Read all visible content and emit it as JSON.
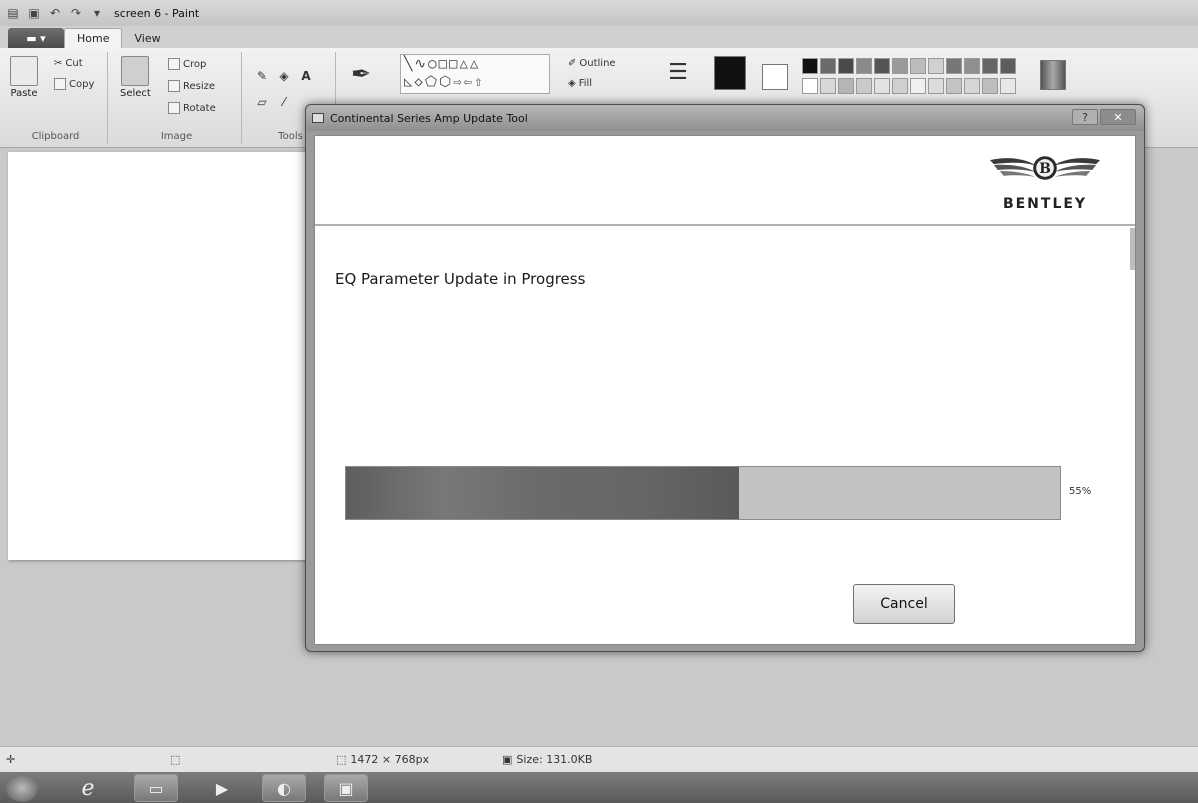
{
  "paint": {
    "window_title": "screen 6 - Paint",
    "tabs": [
      "Home",
      "View"
    ],
    "clipboard": {
      "paste": "Paste",
      "cut": "Cut",
      "copy": "Copy",
      "label": "Clipboard"
    },
    "image": {
      "select": "Select",
      "crop": "Crop",
      "resize": "Resize",
      "rotate": "Rotate",
      "label": "Image"
    },
    "tools": {
      "label": "Tools"
    },
    "shapes": {
      "outline": "Outline",
      "fill": "Fill"
    },
    "status": {
      "dimensions": "1472 × 768px",
      "size": "Size: 131.0KB"
    }
  },
  "dialog": {
    "title": "Continental Series Amp Update Tool",
    "caption_help": "?",
    "caption_close": "✕",
    "brand": "BENTLEY",
    "status_text": "EQ Parameter Update in Progress",
    "progress_value": 0.55,
    "progress_label": "55%",
    "cancel_label": "Cancel"
  },
  "icons": [
    "save-icon",
    "undo-icon",
    "redo-icon",
    "paste-icon",
    "cut-icon",
    "copy-icon",
    "crop-icon",
    "resize-icon",
    "rotate-icon",
    "pencil-icon",
    "fill-icon",
    "text-icon",
    "eraser-icon",
    "color-picker-icon",
    "brush-icon",
    "bentley-wings-logo",
    "start-icon",
    "ie-icon",
    "explorer-icon",
    "media-player-icon",
    "paint-icon",
    "app-icon"
  ]
}
